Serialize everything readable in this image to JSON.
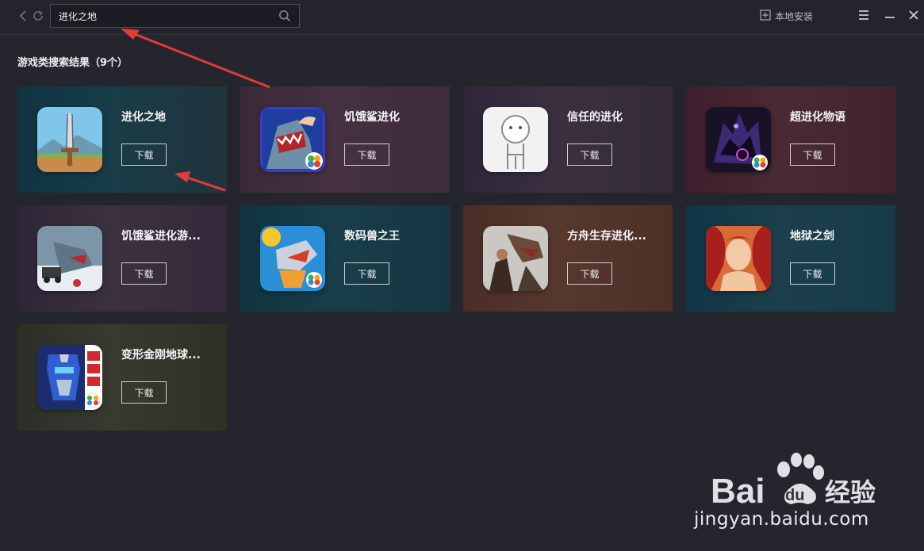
{
  "toolbar": {
    "search_value": "进化之地",
    "local_install_label": "本地安装"
  },
  "results": {
    "title": "游戏类搜索结果（9个）"
  },
  "games": [
    {
      "name": "进化之地",
      "button": "下载"
    },
    {
      "name": "饥饿鲨进化",
      "button": "下载"
    },
    {
      "name": "信任的进化",
      "button": "下载"
    },
    {
      "name": "超进化物语",
      "button": "下载"
    },
    {
      "name": "饥饿鲨进化游...",
      "button": "下载"
    },
    {
      "name": "数码兽之王",
      "button": "下载"
    },
    {
      "name": "方舟生存进化...",
      "button": "下载"
    },
    {
      "name": "地狱之剑",
      "button": "下载"
    },
    {
      "name": "变形金刚地球...",
      "button": "下载"
    }
  ],
  "icons": {
    "back": "back-arrow-icon",
    "refresh": "refresh-icon",
    "search": "search-icon",
    "install": "install-icon",
    "menu": "menu-icon",
    "minimize": "minimize-icon",
    "close": "close-icon"
  },
  "watermark": {
    "brand": "Baidu经验",
    "url": "jingyan.baidu.com"
  },
  "colors": {
    "annotation_arrow": "#e53a3a",
    "background": "#25262d"
  }
}
